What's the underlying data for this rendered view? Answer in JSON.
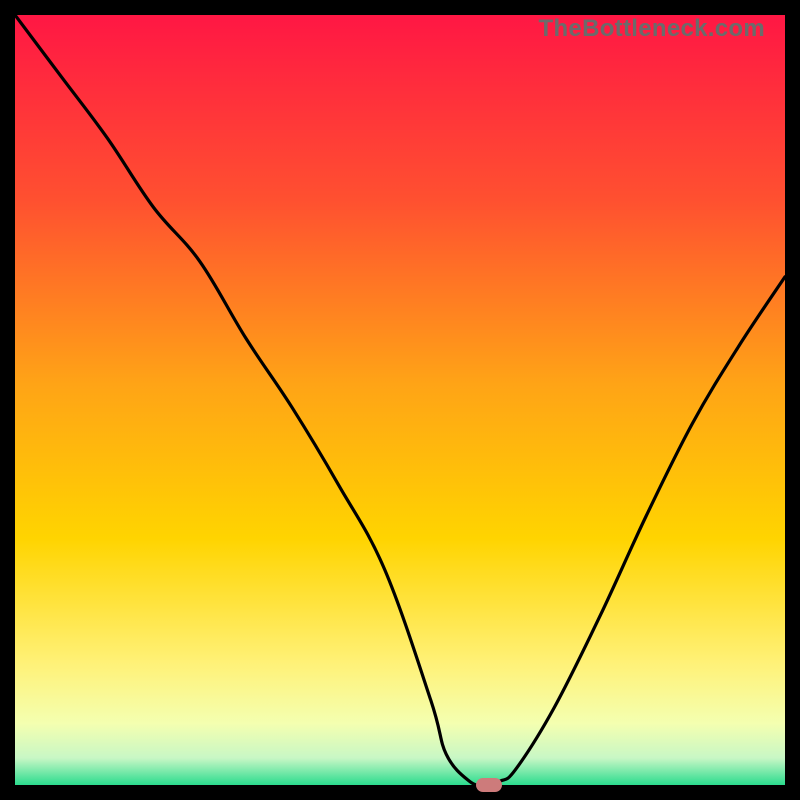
{
  "watermark": "TheBottleneck.com",
  "colors": {
    "top": "#ff1744",
    "mid1": "#ff8a00",
    "mid2": "#ffd400",
    "mid3": "#fff176",
    "mid4": "#f4ffb0",
    "bottom": "#2bdc8e",
    "curve": "#000000",
    "marker": "#cd7b7b",
    "frame": "#000000"
  },
  "chart_data": {
    "type": "line",
    "title": "",
    "xlabel": "",
    "ylabel": "",
    "xlim": [
      0,
      100
    ],
    "ylim": [
      0,
      100
    ],
    "series": [
      {
        "name": "bottleneck-curve",
        "x": [
          0,
          6,
          12,
          18,
          24,
          30,
          36,
          42,
          48,
          54,
          56,
          59,
          61,
          63,
          65,
          70,
          76,
          82,
          88,
          94,
          100
        ],
        "y": [
          100,
          92,
          84,
          75,
          68,
          58,
          49,
          39,
          28,
          11,
          4,
          0.5,
          0,
          0.5,
          2,
          10,
          22,
          35,
          47,
          57,
          66
        ]
      }
    ],
    "marker": {
      "x": 61.5,
      "y": 0
    },
    "grid": false,
    "legend": false
  }
}
